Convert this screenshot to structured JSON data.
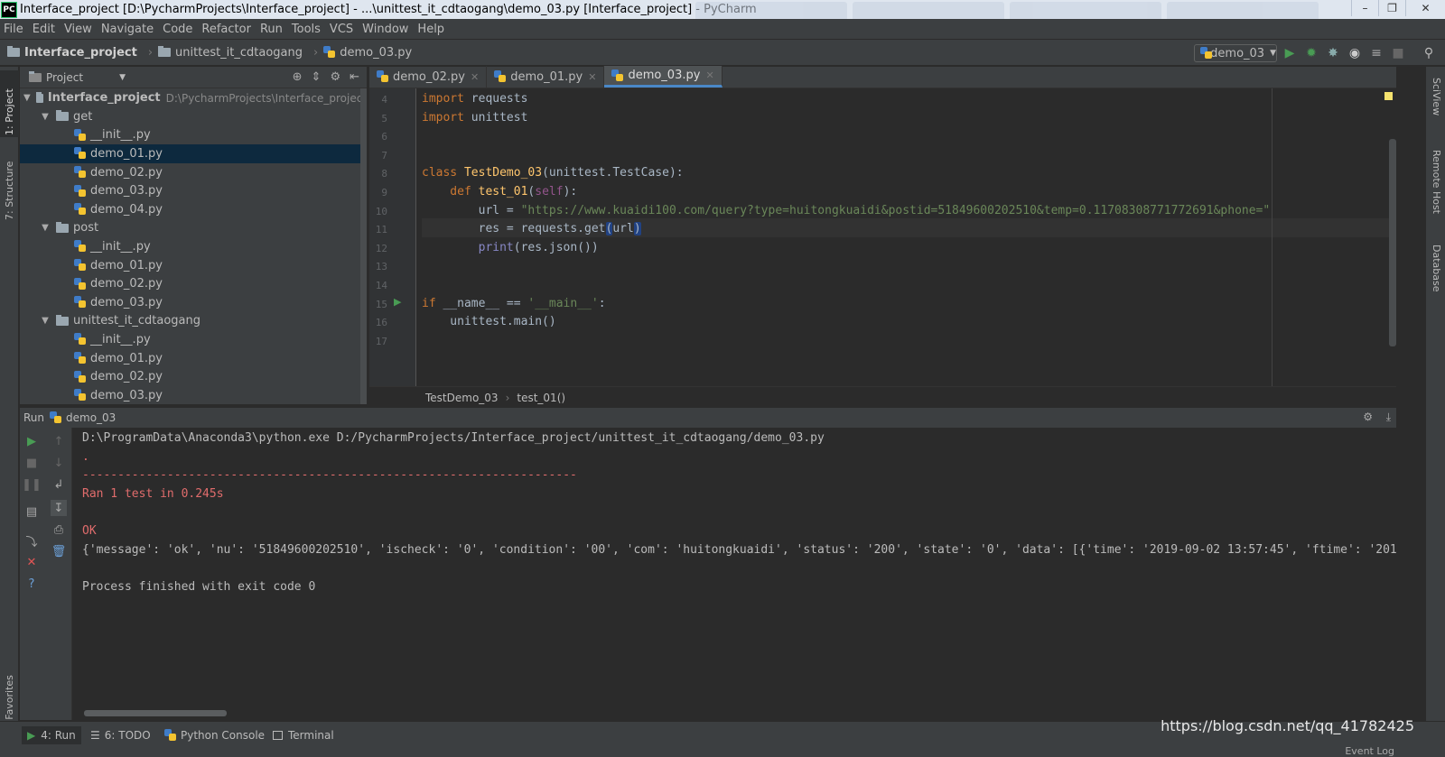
{
  "window": {
    "title": "Interface_project [D:\\PycharmProjects\\Interface_project] - ...\\unittest_it_cdtaogang\\demo_03.py [Interface_project] - PyCharm",
    "logo": "PC",
    "controls": [
      "minimize",
      "maximize",
      "close"
    ]
  },
  "menu": [
    "File",
    "Edit",
    "View",
    "Navigate",
    "Code",
    "Refactor",
    "Run",
    "Tools",
    "VCS",
    "Window",
    "Help"
  ],
  "breadcrumb": [
    "Interface_project",
    "unittest_it_cdtaogang",
    "demo_03.py"
  ],
  "run_config": "demo_03",
  "toolbar_icons": [
    "run-icon",
    "debug-icon",
    "coverage-icon",
    "profile-icon",
    "concurrency-icon",
    "stop-icon",
    "search-icon"
  ],
  "left_tool_tabs": [
    "1: Project",
    "7: Structure",
    "2: Favorites"
  ],
  "right_tool_tabs": [
    "SciView",
    "Remote Host",
    "Database"
  ],
  "project_panel": {
    "title": "Project",
    "root": {
      "name": "Interface_project",
      "path": "D:\\PycharmProjects\\Interface_project"
    },
    "tree": [
      {
        "type": "folder",
        "name": "get",
        "level": 1
      },
      {
        "type": "file",
        "name": "__init__.py",
        "level": 2
      },
      {
        "type": "file",
        "name": "demo_01.py",
        "level": 2,
        "selected": true
      },
      {
        "type": "file",
        "name": "demo_02.py",
        "level": 2
      },
      {
        "type": "file",
        "name": "demo_03.py",
        "level": 2
      },
      {
        "type": "file",
        "name": "demo_04.py",
        "level": 2
      },
      {
        "type": "folder",
        "name": "post",
        "level": 1
      },
      {
        "type": "file",
        "name": "__init__.py",
        "level": 2
      },
      {
        "type": "file",
        "name": "demo_01.py",
        "level": 2
      },
      {
        "type": "file",
        "name": "demo_02.py",
        "level": 2
      },
      {
        "type": "file",
        "name": "demo_03.py",
        "level": 2
      },
      {
        "type": "folder",
        "name": "unittest_it_cdtaogang",
        "level": 1
      },
      {
        "type": "file",
        "name": "__init__.py",
        "level": 2
      },
      {
        "type": "file",
        "name": "demo_01.py",
        "level": 2
      },
      {
        "type": "file",
        "name": "demo_02.py",
        "level": 2
      },
      {
        "type": "file",
        "name": "demo_03.py",
        "level": 2
      }
    ]
  },
  "editor": {
    "tabs": [
      {
        "label": "demo_02.py",
        "active": false
      },
      {
        "label": "demo_01.py",
        "active": false
      },
      {
        "label": "demo_03.py",
        "active": true
      }
    ],
    "line_numbers": [
      "4",
      "5",
      "6",
      "7",
      "8",
      "9",
      "10",
      "11",
      "12",
      "13",
      "14",
      "15",
      "16",
      "17"
    ],
    "code": {
      "l4_kw": "import",
      "l4_rest": " requests",
      "l5_kw": "import",
      "l5_rest": " unittest",
      "l8_kw": "class",
      "l8_name": " TestDemo_03",
      "l8_rest": "(unittest.TestCase):",
      "l9_kw": "    def",
      "l9_name": " test_01",
      "l9_p1": "(",
      "l9_self": "self",
      "l9_p2": "):",
      "l10_pre": "        url = ",
      "l10_str": "\"https://www.kuaidi100.com/query?type=huitongkuaidi&postid=51849600202510&temp=0.11708308771772691&phone=\"",
      "l11_pre": "        res = requests.get",
      "l11_hl1": "(",
      "l11_mid": "url",
      "l11_hl2": ")",
      "l12_pre": "        ",
      "l12_bi": "print",
      "l12_rest": "(res.json())",
      "l15_kw": "if",
      "l15_mid": " __name__ == ",
      "l15_str": "'__main__'",
      "l15_end": ":",
      "l16": "    unittest.main()"
    },
    "breadcrumb": [
      "TestDemo_03",
      "test_01()"
    ]
  },
  "run_panel": {
    "label": "Run",
    "config": "demo_03",
    "output": {
      "cmd": "D:\\ProgramData\\Anaconda3\\python.exe D:/PycharmProjects/Interface_project/unittest_it_cdtaogang/demo_03.py",
      "dot": ".",
      "dashes": "----------------------------------------------------------------------",
      "ran": "Ran 1 test in 0.245s",
      "ok": "OK",
      "json": "{'message': 'ok', 'nu': '51849600202510', 'ischeck': '0', 'condition': '00', 'com': 'huitongkuaidi', 'status': '200', 'state': '0', 'data': [{'time': '2019-09-02 13:57:45', 'ftime': '201",
      "finished": "Process finished with exit code 0"
    }
  },
  "status_tabs": [
    {
      "label": "4: Run",
      "active": true
    },
    {
      "label": "6: TODO",
      "active": false
    },
    {
      "label": "Python Console",
      "active": false
    },
    {
      "label": "Terminal",
      "active": false
    }
  ],
  "watermark": "https://blog.csdn.net/qq_41782425",
  "event_log": "Event Log",
  "colors": {
    "accent": "#4a88c7",
    "keyword": "#cc7832",
    "string": "#6a8759",
    "function": "#ffc66d",
    "error": "#e06c6c",
    "run_green": "#499c54"
  }
}
